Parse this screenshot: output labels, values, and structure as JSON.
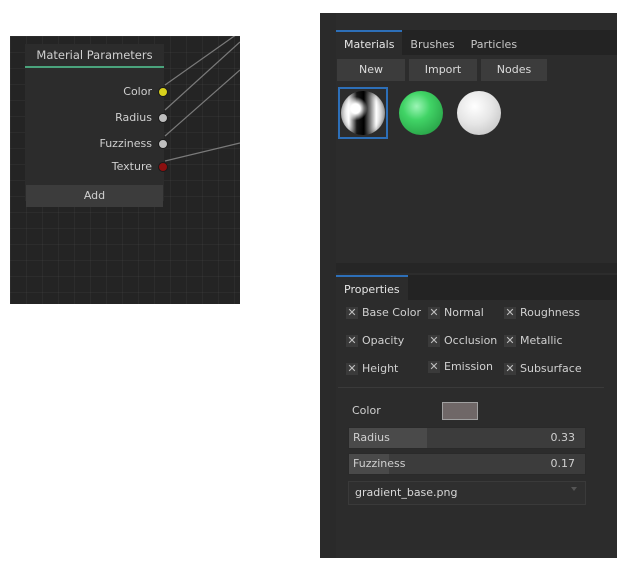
{
  "node_editor": {
    "node": {
      "title": "Material Parameters",
      "ports": [
        {
          "label": "Color",
          "color": "#d8d11c"
        },
        {
          "label": "Radius",
          "color": "#bdbdbd"
        },
        {
          "label": "Fuzziness",
          "color": "#bdbdbd"
        },
        {
          "label": "Texture",
          "color": "#8c1010"
        }
      ],
      "add_label": "Add"
    }
  },
  "panel": {
    "tabs": [
      "Materials",
      "Brushes",
      "Particles"
    ],
    "buttons": [
      "New",
      "Import",
      "Nodes"
    ],
    "material_previews": [
      "chrome",
      "green",
      "white"
    ],
    "properties_tab": "Properties",
    "checkboxes": [
      {
        "label": "Base Color"
      },
      {
        "label": "Normal"
      },
      {
        "label": "Roughness"
      },
      {
        "label": "Opacity"
      },
      {
        "label": "Occlusion"
      },
      {
        "label": "Metallic"
      },
      {
        "label": "Height"
      },
      {
        "label": "Emission"
      },
      {
        "label": "Subsurface"
      }
    ],
    "color": {
      "label": "Color",
      "value": "#6f6767"
    },
    "sliders": [
      {
        "label": "Radius",
        "value": "0.33",
        "fraction": 0.33
      },
      {
        "label": "Fuzziness",
        "value": "0.17",
        "fraction": 0.17
      }
    ],
    "texture_file": "gradient_base.png"
  },
  "colors": {
    "accent_blue": "#2d6fb8",
    "node_title_underline": "#4aa37c"
  }
}
